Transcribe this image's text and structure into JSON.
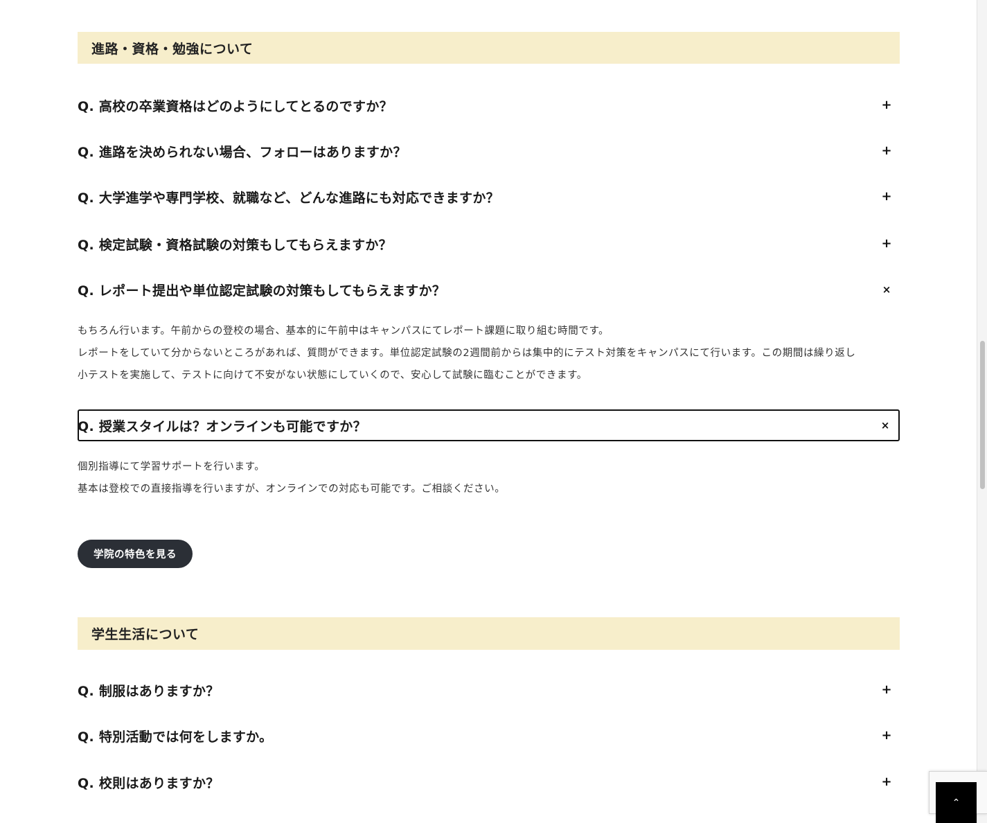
{
  "section1": {
    "title": "進路・資格・勉強について",
    "faqs": [
      {
        "q": "Q. 高校の卒業資格はどのようにしてとるのですか？",
        "toggle": "+"
      },
      {
        "q": "Q. 進路を決められない場合、フォローはありますか？",
        "toggle": "+"
      },
      {
        "q": "Q. 大学進学や専門学校、就職など、どんな進路にも対応できますか？",
        "toggle": "+"
      },
      {
        "q": "Q. 検定試験・資格試験の対策もしてもらえますか？",
        "toggle": "+"
      },
      {
        "q": "Q. レポート提出や単位認定試験の対策もしてもらえますか？",
        "toggle": "×",
        "answer": [
          "もちろん行います。午前からの登校の場合、基本的に午前中はキャンパスにてレポート課題に取り組む時間です。",
          "レポートをしていて分からないところがあれば、質問ができます。単位認定試験の2週間前からは集中的にテスト対策をキャンパスにて行います。この期間は繰り返し",
          "小テストを実施して、テストに向けて不安がない状態にしていくので、安心して試験に臨むことができます。"
        ]
      },
      {
        "q": "Q. 授業スタイルは？オンラインも可能ですか？",
        "toggle": "×",
        "answer": [
          "個別指導にて学習サポートを行います。",
          "基本は登校での直接指導を行いますが、オンラインでの対応も可能です。ご相談ください。"
        ]
      }
    ],
    "button_label": "学院の特色を見る"
  },
  "section2": {
    "title": "学生生活について",
    "faqs": [
      {
        "q": "Q. 制服はありますか？",
        "toggle": "+"
      },
      {
        "q": "Q. 特別活動では何をしますか。",
        "toggle": "+"
      },
      {
        "q": "Q. 校則はありますか？",
        "toggle": "+"
      }
    ]
  },
  "to_top_icon": "chevron-up-icon",
  "to_top_glyph": "⌃",
  "colors": {
    "section_bg": "#f7eecb",
    "button_bg": "#2b2f36",
    "to_top_bg": "#000000"
  }
}
